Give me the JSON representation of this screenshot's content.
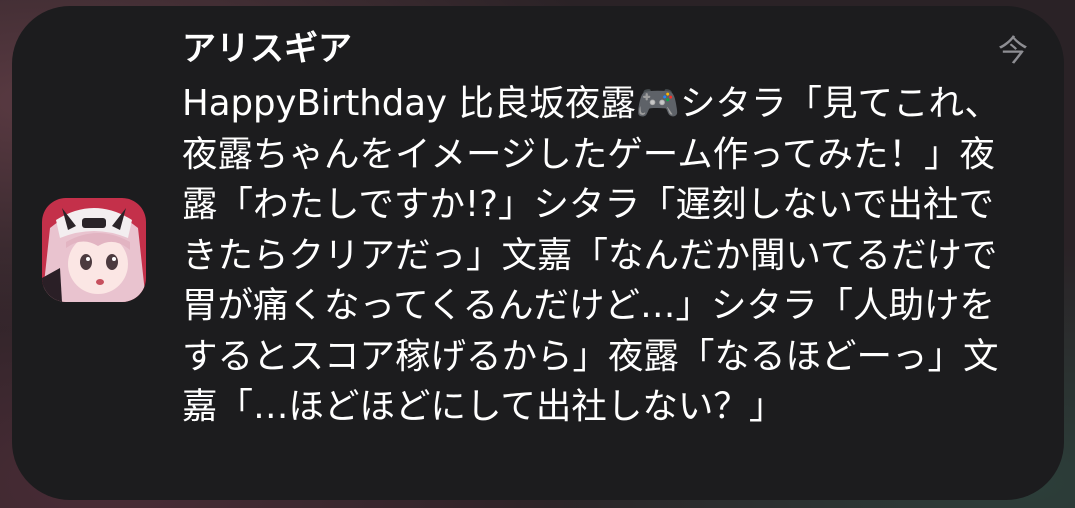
{
  "notification": {
    "app_name": "アリスギア",
    "timestamp": "今",
    "app_icon": "alice-gear-character-icon",
    "message": "HappyBirthday 比良坂夜露🎮シタラ「見てこれ、夜露ちゃんをイメージしたゲーム作ってみた！」夜露「わたしですか!?」シタラ「遅刻しないで出社できたらクリアだっ」文嘉「なんだか聞いてるだけで胃が痛くなってくるんだけど…」シタラ「人助けをするとスコア稼げるから」夜露「なるほどーっ」文嘉「…ほどほどにして出社しない？」"
  },
  "colors": {
    "card_background": "#1c1c1e",
    "primary_text": "#ffffff",
    "secondary_text": "#8e8e93"
  }
}
